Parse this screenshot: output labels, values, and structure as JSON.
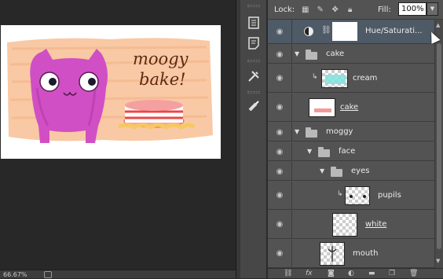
{
  "status": {
    "zoom": "66.67%"
  },
  "document": {
    "title_line1": "moogy",
    "title_line2": "bake!"
  },
  "toolstrip": {
    "icons": [
      "history-icon",
      "notes-icon",
      "tools-icon",
      "brush-icon"
    ]
  },
  "layers_panel": {
    "lock_label": "Lock:",
    "fill_label": "Fill:",
    "fill_value": "100%",
    "layers": [
      {
        "name": "Hue/Saturati...",
        "type": "adjustment",
        "selected": true
      },
      {
        "name": "cake",
        "type": "group",
        "expanded": true
      },
      {
        "name": "cream",
        "type": "layer",
        "clipped": true
      },
      {
        "name": "cake",
        "type": "layer"
      },
      {
        "name": "moggy",
        "type": "group",
        "expanded": true
      },
      {
        "name": "face",
        "type": "group",
        "expanded": true
      },
      {
        "name": "eyes",
        "type": "group",
        "expanded": true
      },
      {
        "name": "pupils",
        "type": "layer",
        "clipped": true
      },
      {
        "name": "white",
        "type": "layer"
      },
      {
        "name": "mouth",
        "type": "layer"
      }
    ]
  },
  "colors": {
    "panel_bg": "#535353",
    "selected_row": "#4e5a66",
    "canvas_bg": "#282828",
    "cat_pink": "#d14fc4",
    "peach": "#f7c39a",
    "cream_cyan": "#7ee3dc"
  }
}
